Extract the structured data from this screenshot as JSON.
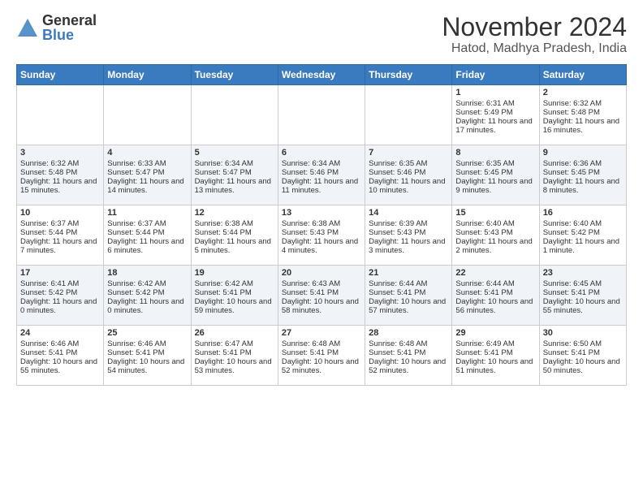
{
  "header": {
    "logo_general": "General",
    "logo_blue": "Blue",
    "main_title": "November 2024",
    "subtitle": "Hatod, Madhya Pradesh, India"
  },
  "days_of_week": [
    "Sunday",
    "Monday",
    "Tuesday",
    "Wednesday",
    "Thursday",
    "Friday",
    "Saturday"
  ],
  "weeks": [
    [
      {
        "day": "",
        "data": ""
      },
      {
        "day": "",
        "data": ""
      },
      {
        "day": "",
        "data": ""
      },
      {
        "day": "",
        "data": ""
      },
      {
        "day": "",
        "data": ""
      },
      {
        "day": "1",
        "data": "Sunrise: 6:31 AM\nSunset: 5:49 PM\nDaylight: 11 hours and 17 minutes."
      },
      {
        "day": "2",
        "data": "Sunrise: 6:32 AM\nSunset: 5:48 PM\nDaylight: 11 hours and 16 minutes."
      }
    ],
    [
      {
        "day": "3",
        "data": "Sunrise: 6:32 AM\nSunset: 5:48 PM\nDaylight: 11 hours and 15 minutes."
      },
      {
        "day": "4",
        "data": "Sunrise: 6:33 AM\nSunset: 5:47 PM\nDaylight: 11 hours and 14 minutes."
      },
      {
        "day": "5",
        "data": "Sunrise: 6:34 AM\nSunset: 5:47 PM\nDaylight: 11 hours and 13 minutes."
      },
      {
        "day": "6",
        "data": "Sunrise: 6:34 AM\nSunset: 5:46 PM\nDaylight: 11 hours and 11 minutes."
      },
      {
        "day": "7",
        "data": "Sunrise: 6:35 AM\nSunset: 5:46 PM\nDaylight: 11 hours and 10 minutes."
      },
      {
        "day": "8",
        "data": "Sunrise: 6:35 AM\nSunset: 5:45 PM\nDaylight: 11 hours and 9 minutes."
      },
      {
        "day": "9",
        "data": "Sunrise: 6:36 AM\nSunset: 5:45 PM\nDaylight: 11 hours and 8 minutes."
      }
    ],
    [
      {
        "day": "10",
        "data": "Sunrise: 6:37 AM\nSunset: 5:44 PM\nDaylight: 11 hours and 7 minutes."
      },
      {
        "day": "11",
        "data": "Sunrise: 6:37 AM\nSunset: 5:44 PM\nDaylight: 11 hours and 6 minutes."
      },
      {
        "day": "12",
        "data": "Sunrise: 6:38 AM\nSunset: 5:44 PM\nDaylight: 11 hours and 5 minutes."
      },
      {
        "day": "13",
        "data": "Sunrise: 6:38 AM\nSunset: 5:43 PM\nDaylight: 11 hours and 4 minutes."
      },
      {
        "day": "14",
        "data": "Sunrise: 6:39 AM\nSunset: 5:43 PM\nDaylight: 11 hours and 3 minutes."
      },
      {
        "day": "15",
        "data": "Sunrise: 6:40 AM\nSunset: 5:43 PM\nDaylight: 11 hours and 2 minutes."
      },
      {
        "day": "16",
        "data": "Sunrise: 6:40 AM\nSunset: 5:42 PM\nDaylight: 11 hours and 1 minute."
      }
    ],
    [
      {
        "day": "17",
        "data": "Sunrise: 6:41 AM\nSunset: 5:42 PM\nDaylight: 11 hours and 0 minutes."
      },
      {
        "day": "18",
        "data": "Sunrise: 6:42 AM\nSunset: 5:42 PM\nDaylight: 11 hours and 0 minutes."
      },
      {
        "day": "19",
        "data": "Sunrise: 6:42 AM\nSunset: 5:41 PM\nDaylight: 10 hours and 59 minutes."
      },
      {
        "day": "20",
        "data": "Sunrise: 6:43 AM\nSunset: 5:41 PM\nDaylight: 10 hours and 58 minutes."
      },
      {
        "day": "21",
        "data": "Sunrise: 6:44 AM\nSunset: 5:41 PM\nDaylight: 10 hours and 57 minutes."
      },
      {
        "day": "22",
        "data": "Sunrise: 6:44 AM\nSunset: 5:41 PM\nDaylight: 10 hours and 56 minutes."
      },
      {
        "day": "23",
        "data": "Sunrise: 6:45 AM\nSunset: 5:41 PM\nDaylight: 10 hours and 55 minutes."
      }
    ],
    [
      {
        "day": "24",
        "data": "Sunrise: 6:46 AM\nSunset: 5:41 PM\nDaylight: 10 hours and 55 minutes."
      },
      {
        "day": "25",
        "data": "Sunrise: 6:46 AM\nSunset: 5:41 PM\nDaylight: 10 hours and 54 minutes."
      },
      {
        "day": "26",
        "data": "Sunrise: 6:47 AM\nSunset: 5:41 PM\nDaylight: 10 hours and 53 minutes."
      },
      {
        "day": "27",
        "data": "Sunrise: 6:48 AM\nSunset: 5:41 PM\nDaylight: 10 hours and 52 minutes."
      },
      {
        "day": "28",
        "data": "Sunrise: 6:48 AM\nSunset: 5:41 PM\nDaylight: 10 hours and 52 minutes."
      },
      {
        "day": "29",
        "data": "Sunrise: 6:49 AM\nSunset: 5:41 PM\nDaylight: 10 hours and 51 minutes."
      },
      {
        "day": "30",
        "data": "Sunrise: 6:50 AM\nSunset: 5:41 PM\nDaylight: 10 hours and 50 minutes."
      }
    ]
  ]
}
